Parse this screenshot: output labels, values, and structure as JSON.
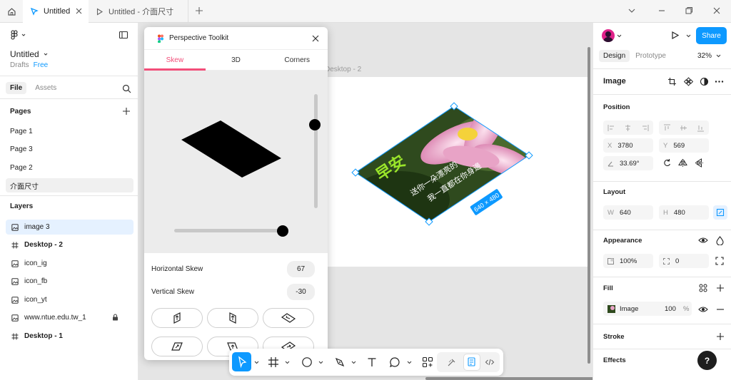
{
  "tabs": [
    {
      "label": "Untitled"
    },
    {
      "label": "Untitled - 介面尺寸"
    }
  ],
  "left": {
    "file_title": "Untitled",
    "drafts": "Drafts",
    "plan": "Free",
    "tab_file": "File",
    "tab_assets": "Assets",
    "pages_label": "Pages",
    "pages": [
      "Page 1",
      "Page 3",
      "Page 2",
      "介面尺寸"
    ],
    "layers_label": "Layers",
    "layers": [
      {
        "name": "image 3",
        "kind": "image"
      },
      {
        "name": "Desktop - 2",
        "kind": "frame"
      },
      {
        "name": "icon_ig",
        "kind": "image"
      },
      {
        "name": "icon_fb",
        "kind": "image"
      },
      {
        "name": "icon_yt",
        "kind": "image"
      },
      {
        "name": "www.ntue.edu.tw_1",
        "kind": "image"
      },
      {
        "name": "Desktop - 1",
        "kind": "frame"
      }
    ]
  },
  "canvas": {
    "frame_label": "Desktop - 2",
    "dimensions": "640 × 480",
    "image_text_big": "早安",
    "image_text_line1": "送你一朵漂亮的",
    "image_text_line2": "我一直都在你身邊"
  },
  "plugin": {
    "title": "Perspective Toolkit",
    "tabs": [
      "Skew",
      "3D",
      "Corners"
    ],
    "active_tab": "Skew",
    "horizontal_label": "Horizontal Skew",
    "horizontal_value": "67",
    "vertical_label": "Vertical Skew",
    "vertical_value": "-30"
  },
  "right": {
    "share": "Share",
    "tab_design": "Design",
    "tab_prototype": "Prototype",
    "zoom": "32%",
    "selection": "Image",
    "position_label": "Position",
    "x_label": "X",
    "x_value": "3780",
    "y_label": "Y",
    "y_value": "569",
    "rotation": "33.69°",
    "layout_label": "Layout",
    "w_label": "W",
    "w_value": "640",
    "h_label": "H",
    "h_value": "480",
    "appearance_label": "Appearance",
    "opacity": "100%",
    "radius": "0",
    "fill_label": "Fill",
    "fill_type": "Image",
    "fill_opacity": "100",
    "fill_unit": "%",
    "stroke_label": "Stroke",
    "effects_label": "Effects",
    "help": "?"
  },
  "colors": {
    "accent": "#0d99ff",
    "plugin_accent": "#f24e79"
  }
}
